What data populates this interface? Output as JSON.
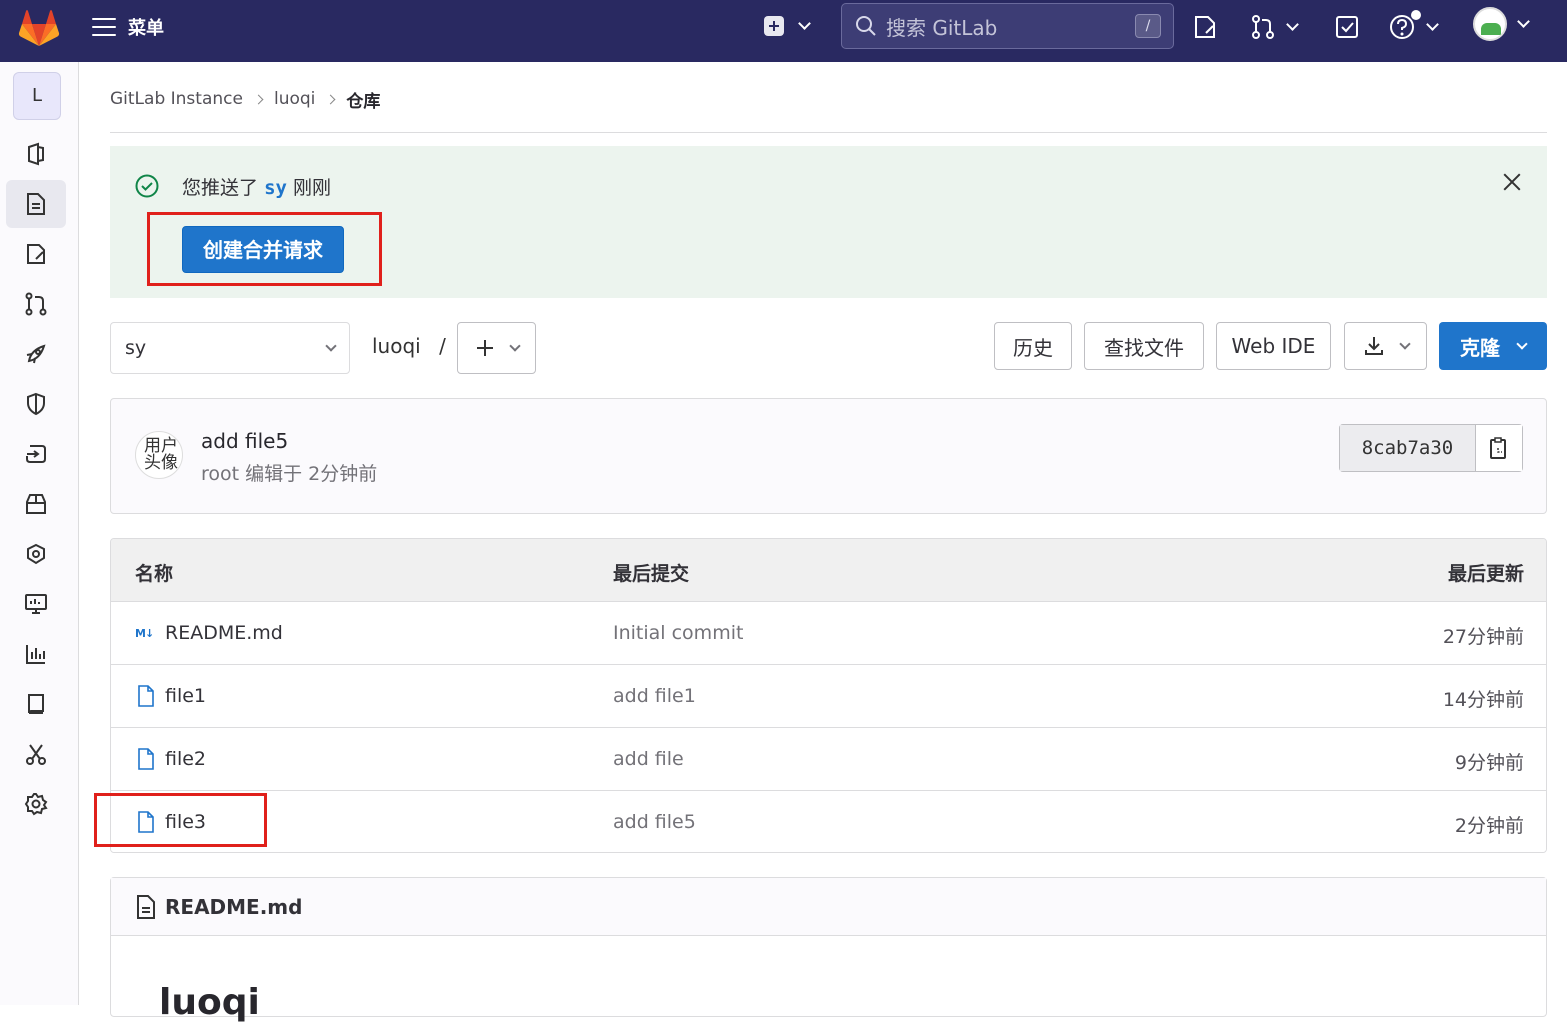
{
  "navbar": {
    "menu_label": "菜单",
    "search_placeholder": "搜索 GitLab",
    "search_shortcut": "/"
  },
  "sidebar": {
    "project_initial": "L",
    "items": [
      "project-overview",
      "repository",
      "issues",
      "merge-requests",
      "ci-cd",
      "security",
      "deployments",
      "packages",
      "infrastructure",
      "monitor",
      "analytics",
      "wiki",
      "snippets",
      "settings"
    ]
  },
  "breadcrumb": [
    "GitLab Instance",
    "luoqi",
    "仓库"
  ],
  "alert": {
    "text_before": "您推送了",
    "branch": "sy",
    "text_after": "刚刚",
    "button_label": "创建合并请求"
  },
  "toolbar": {
    "branch": "sy",
    "path": "luoqi",
    "path_sep": "/",
    "history": "历史",
    "find_file": "查找文件",
    "web_ide": "Web IDE",
    "clone": "克隆"
  },
  "last_commit": {
    "avatar_alt": "用户头像",
    "title": "add file5",
    "meta": "root 编辑于 2分钟前",
    "sha": "8cab7a30"
  },
  "file_table": {
    "headers": {
      "name": "名称",
      "last_commit": "最后提交",
      "last_update": "最后更新"
    },
    "rows": [
      {
        "name": "README.md",
        "icon": "markdown-icon",
        "commit": "Initial commit",
        "time": "27分钟前"
      },
      {
        "name": "file1",
        "icon": "file-icon",
        "commit": "add file1",
        "time": "14分钟前"
      },
      {
        "name": "file2",
        "icon": "file-icon",
        "commit": "add file",
        "time": "9分钟前"
      },
      {
        "name": "file3",
        "icon": "file-icon",
        "commit": "add file5",
        "time": "2分钟前"
      }
    ]
  },
  "readme": {
    "filename": "README.md",
    "heading": "luoqi"
  },
  "colors": {
    "navbar": "#292961",
    "primary": "#1f75cb",
    "alert_bg": "#ecf4ee",
    "highlight_red": "#e0201b"
  }
}
